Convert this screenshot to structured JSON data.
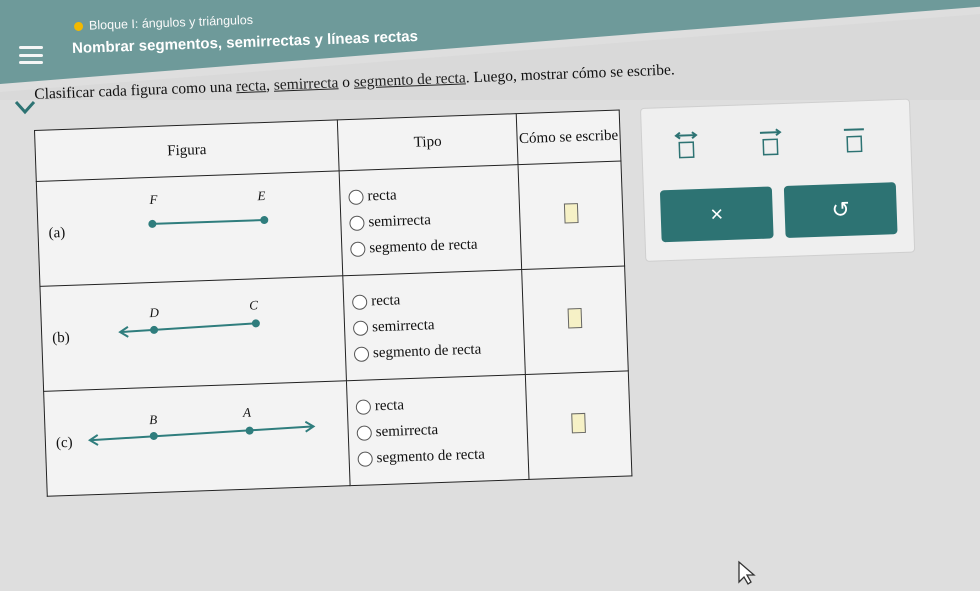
{
  "header": {
    "chapter": "Bloque I: ángulos y triángulos",
    "title": "Nombrar segmentos, semirrectas y líneas rectas"
  },
  "instructions": {
    "prefix": "Clasificar cada figura como una ",
    "link1": "recta",
    "sep1": ", ",
    "link2": "semirrecta",
    "sep2": " o ",
    "link3": "segmento de recta",
    "suffix": ". Luego, mostrar cómo se escribe."
  },
  "table": {
    "headers": {
      "figura": "Figura",
      "tipo": "Tipo",
      "como": "Cómo se escribe"
    },
    "options": [
      "recta",
      "semirrecta",
      "segmento de recta"
    ],
    "rows": [
      {
        "label": "(a)",
        "p1": "F",
        "p2": "E"
      },
      {
        "label": "(b)",
        "p1": "D",
        "p2": "C"
      },
      {
        "label": "(c)",
        "p1": "B",
        "p2": "A"
      }
    ]
  },
  "side_panel": {
    "buttons": {
      "clear": "×",
      "undo": "↺"
    },
    "symbols": [
      "line-notation-icon",
      "ray-notation-icon",
      "segment-notation-icon"
    ]
  },
  "colors": {
    "accent": "#2d7373",
    "header": "#6e9a9a",
    "dot": "#2d7373"
  }
}
